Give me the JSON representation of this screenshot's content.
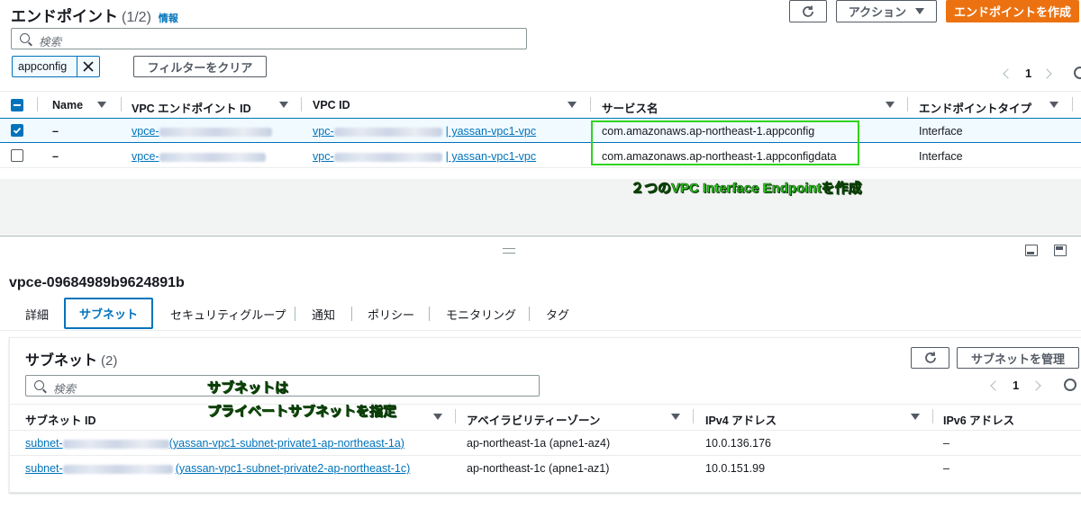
{
  "header": {
    "title": "エンドポイント",
    "count": "(1/2)",
    "info_link": "情報",
    "actions_label": "アクション",
    "create_label": "エンドポイントを作成"
  },
  "search": {
    "placeholder": "検索"
  },
  "filter": {
    "token": "appconfig",
    "clear_label": "フィルターをクリア"
  },
  "pagination": {
    "page": "1"
  },
  "table": {
    "columns": [
      "Name",
      "VPC エンドポイント ID",
      "VPC ID",
      "サービス名",
      "エンドポイントタイプ"
    ],
    "rows": [
      {
        "name": "–",
        "endpoint_id_prefix": "vpce-",
        "vpc_prefix": "vpc-",
        "vpc_suffix": "| yassan-vpc1-vpc",
        "service": "com.amazonaws.ap-northeast-1.appconfig",
        "type": "Interface",
        "selected": true
      },
      {
        "name": "–",
        "endpoint_id_prefix": "vpce-",
        "vpc_prefix": "vpc-",
        "vpc_suffix": "| yassan-vpc1-vpc",
        "service": "com.amazonaws.ap-northeast-1.appconfigdata",
        "type": "Interface",
        "selected": false
      }
    ]
  },
  "annotations": {
    "endpoints_note": "２つのVPC Interface Endpointを作成",
    "subnet_note_line1": "サブネットは",
    "subnet_note_line2": "プライベートサブネットを指定"
  },
  "detail": {
    "endpoint_id": "vpce-09684989b9624891b",
    "tabs": [
      "詳細",
      "サブネット",
      "セキュリティグループ",
      "通知",
      "ポリシー",
      "モニタリング",
      "タグ"
    ],
    "active_tab": "サブネット"
  },
  "subnets": {
    "title": "サブネット",
    "count": "(2)",
    "manage_label": "サブネットを管理",
    "search_placeholder": "検索",
    "page": "1",
    "columns": [
      "サブネット ID",
      "アベイラビリティーゾーン",
      "IPv4 アドレス",
      "IPv6 アドレス"
    ],
    "rows": [
      {
        "subnet_prefix": "subnet-",
        "subnet_suffix": "(yassan-vpc1-subnet-private1-ap-northeast-1a)",
        "az": "ap-northeast-1a (apne1-az4)",
        "ipv4": "10.0.136.176",
        "ipv6": "–"
      },
      {
        "subnet_prefix": "subnet-",
        "subnet_suffix": "(yassan-vpc1-subnet-private2-ap-northeast-1c)",
        "az": "ap-northeast-1c (apne1-az1)",
        "ipv4": "10.0.151.99",
        "ipv6": "–"
      }
    ]
  },
  "colors": {
    "accent": "#0073bb",
    "primary": "#ec7211",
    "highlight": "#2fd41f",
    "selected_row": "#f1faff"
  }
}
